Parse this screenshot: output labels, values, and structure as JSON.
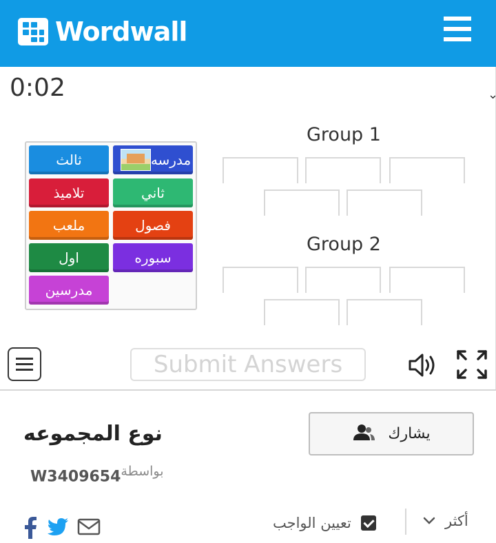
{
  "header": {
    "brand": "Wordwall",
    "bg_color": "#109be5"
  },
  "game": {
    "timer": "0:02",
    "tiles": [
      {
        "label": "مدرسه",
        "color": "#2f4fd0",
        "has_image": true,
        "image": "school-building"
      },
      {
        "label": "ثالث",
        "color": "#1a8de0"
      },
      {
        "label": "ثاني",
        "color": "#2eb873"
      },
      {
        "label": "تلاميذ",
        "color": "#d81e3a"
      },
      {
        "label": "فصول",
        "color": "#e44112"
      },
      {
        "label": "ملعب",
        "color": "#f27512"
      },
      {
        "label": "سبوره",
        "color": "#7b2fe0"
      },
      {
        "label": "اول",
        "color": "#1e8a44"
      },
      {
        "label": "مدرسين",
        "color": "#c642d6"
      }
    ],
    "groups": [
      {
        "title": "Group 1"
      },
      {
        "title": "Group 2"
      }
    ],
    "submit_label": "Submit Answers",
    "icons": [
      "menu-icon",
      "speaker-icon",
      "fullscreen-icon"
    ]
  },
  "info": {
    "title": "نوع المجموعه",
    "by_label": "بواسطة",
    "author": "W3409654",
    "share_label": "يشارك",
    "assign_label": "تعيين الواجب",
    "more_label": "أكثر",
    "social": [
      "facebook-icon",
      "twitter-icon",
      "email-icon"
    ]
  }
}
